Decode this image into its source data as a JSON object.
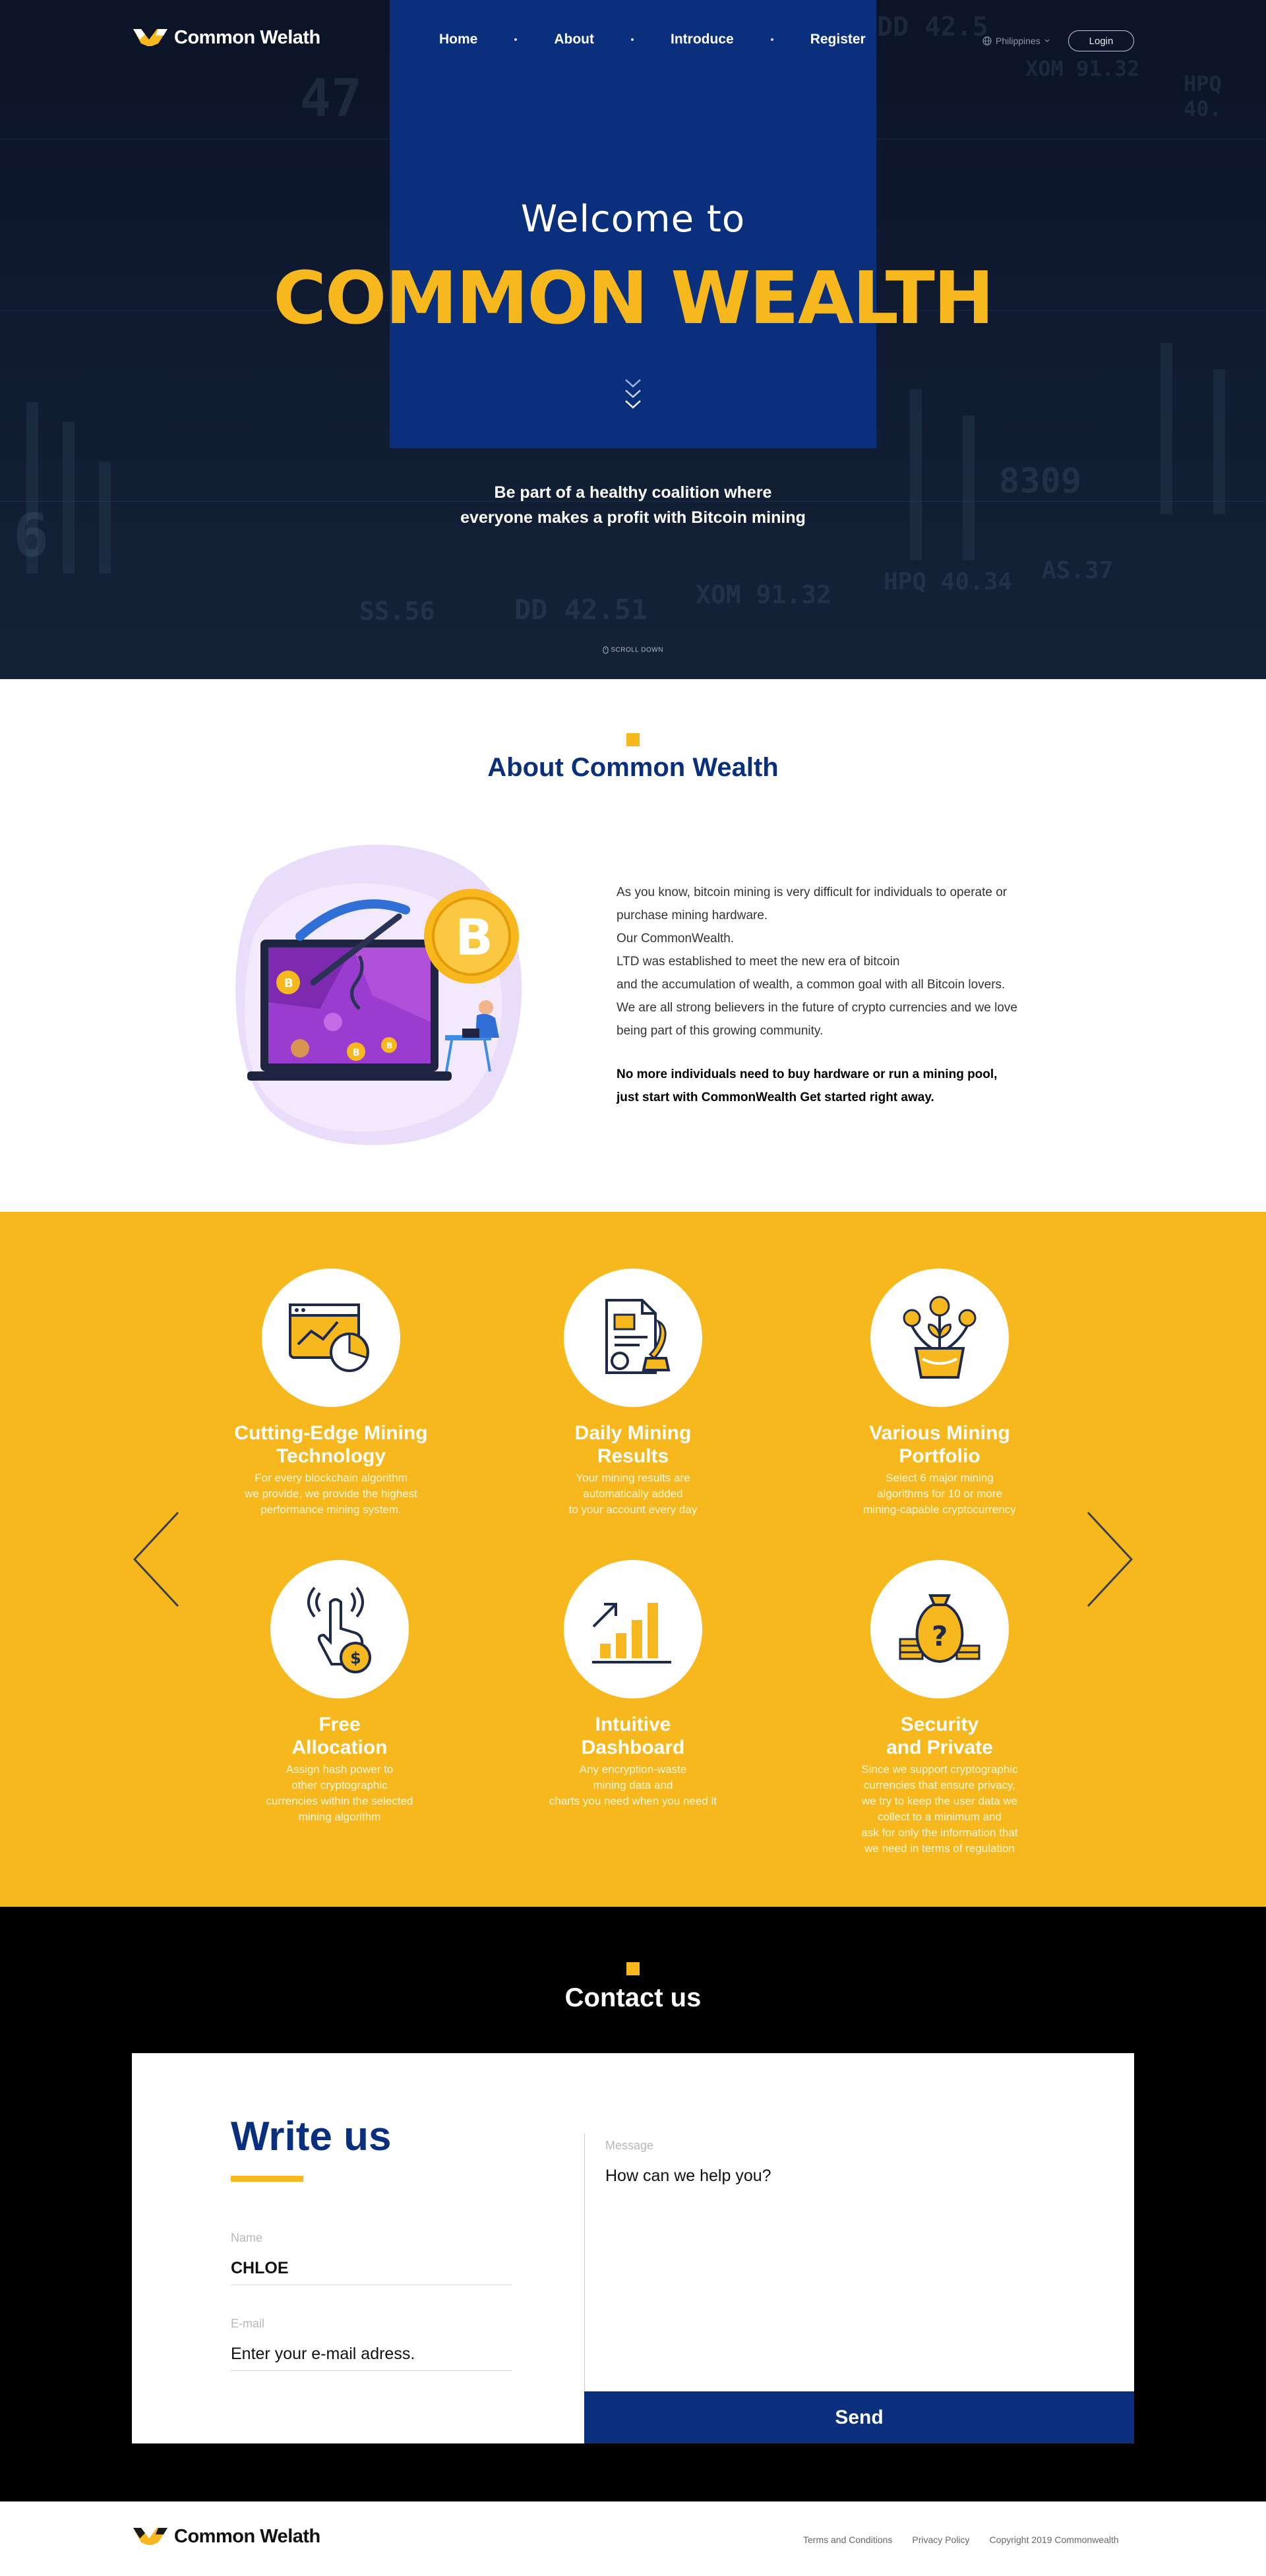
{
  "brand": {
    "name": "Common Welath",
    "colors": {
      "navy": "#0a2f7d",
      "yellow": "#f7b81d",
      "dark": "#0c1426"
    }
  },
  "nav": {
    "items": [
      "Home",
      "About",
      "Introduce",
      "Register"
    ]
  },
  "header": {
    "language": "Philippines",
    "login_label": "Login"
  },
  "hero": {
    "welcome": "Welcome to",
    "title": "COMMON WEALTH",
    "subtitle_line1": "Be part of a healthy coalition where",
    "subtitle_line2": "everyone makes a profit with Bitcoin mining",
    "scroll_label": "SCROLL DOWN",
    "bg_numbers": [
      "47",
      "DD 42.5",
      "XOM 91.32",
      "HPQ 40.",
      "8309",
      "SS.56",
      "DD 42.51",
      "XOM 91.32",
      "HPQ 40.34",
      "AS.37",
      "6"
    ]
  },
  "about": {
    "title": "About Common Wealth",
    "paragraph_lines": [
      "As you know, bitcoin mining is very difficult for individuals to operate or",
      "purchase mining hardware.",
      "Our CommonWealth.",
      "LTD was established to meet the new era of bitcoin",
      "and the accumulation of wealth, a common goal with all Bitcoin lovers.",
      "We are all strong believers in the future of crypto currencies and we love",
      "being part of this growing community."
    ],
    "bold_lines": [
      "No more individuals need to buy hardware or run a mining pool,",
      "just start with CommonWealth Get started right away."
    ]
  },
  "features": [
    {
      "icon": "chart-dashboard-icon",
      "title_lines": [
        "Cutting-Edge Mining",
        "Technology"
      ],
      "desc_lines": [
        "For every blockchain algorithm",
        "we provide, we provide the highest",
        "performance mining system."
      ]
    },
    {
      "icon": "certificate-document-icon",
      "title_lines": [
        "Daily Mining",
        "Results"
      ],
      "desc_lines": [
        "Your mining results are",
        "automatically added",
        "to your account every day"
      ]
    },
    {
      "icon": "money-plant-icon",
      "title_lines": [
        "Various Mining",
        "Portfolio"
      ],
      "desc_lines": [
        "Select 6 major mining",
        "algorithms for 10 or more",
        "mining-capable cryptocurrency"
      ]
    },
    {
      "icon": "tap-coin-icon",
      "title_lines": [
        "Free",
        "Allocation"
      ],
      "desc_lines": [
        "Assign hash power to",
        "other cryptographic",
        "currencies within the selected",
        "mining algorithm"
      ]
    },
    {
      "icon": "growth-bars-icon",
      "title_lines": [
        "Intuitive",
        "Dashboard"
      ],
      "desc_lines": [
        "Any encryption-waste",
        "mining data and",
        "charts you need when you need it"
      ]
    },
    {
      "icon": "money-bag-icon",
      "title_lines": [
        "Security",
        "and Private"
      ],
      "desc_lines": [
        "Since we support cryptographic",
        "currencies that ensure privacy,",
        "we try to keep the user data we",
        "collect to a minimum and",
        "ask for only the information that",
        "we need in terms of regulation"
      ]
    }
  ],
  "contact": {
    "title": "Contact us",
    "write_us": "Write us",
    "name_label": "Name",
    "name_value": "CHLOE",
    "email_label": "E-mail",
    "email_placeholder": "Enter your e-mail adress.",
    "message_label": "Message",
    "message_placeholder": "How can we help you?",
    "send_label": "Send"
  },
  "footer": {
    "brand": "Common Welath",
    "links": [
      "Terms and Conditions",
      "Privacy Policy",
      "Copyright 2019 Commonwealth"
    ]
  }
}
